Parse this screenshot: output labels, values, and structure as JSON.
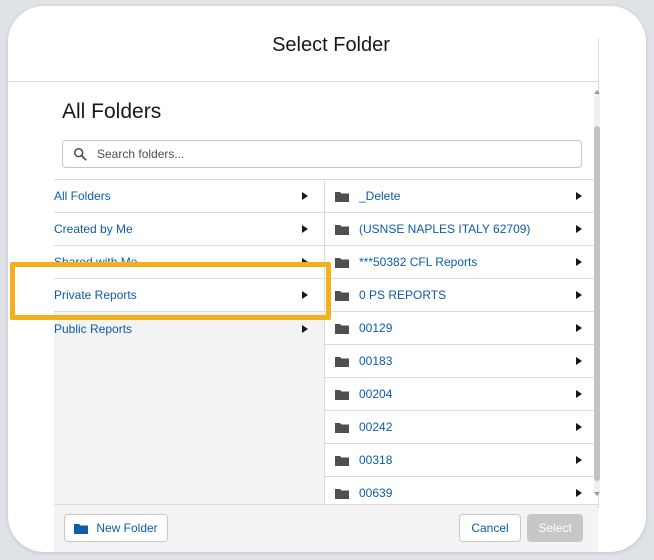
{
  "dialog": {
    "title": "Select Folder"
  },
  "section": {
    "title": "All Folders"
  },
  "search": {
    "placeholder": "Search folders..."
  },
  "categories": [
    {
      "label": "All Folders"
    },
    {
      "label": "Created by Me"
    },
    {
      "label": "Shared with Me"
    },
    {
      "label": "Private Reports"
    },
    {
      "label": "Public Reports"
    }
  ],
  "folders": [
    {
      "label": "_Delete"
    },
    {
      "label": "(USNSE NAPLES ITALY 62709)"
    },
    {
      "label": "***50382 CFL Reports"
    },
    {
      "label": "0 PS REPORTS"
    },
    {
      "label": "00129"
    },
    {
      "label": "00183"
    },
    {
      "label": "00204"
    },
    {
      "label": "00242"
    },
    {
      "label": "00318"
    },
    {
      "label": "00639"
    }
  ],
  "footer": {
    "new_folder_label": "New Folder",
    "cancel_label": "Cancel",
    "select_label": "Select"
  },
  "colors": {
    "link": "#0b5cab",
    "highlight": "#f2b01e",
    "disabled_button": "#c9c7c5"
  },
  "icons": {
    "search": "search-icon",
    "folder": "folder-icon",
    "arrow": "chevron-right-icon"
  }
}
